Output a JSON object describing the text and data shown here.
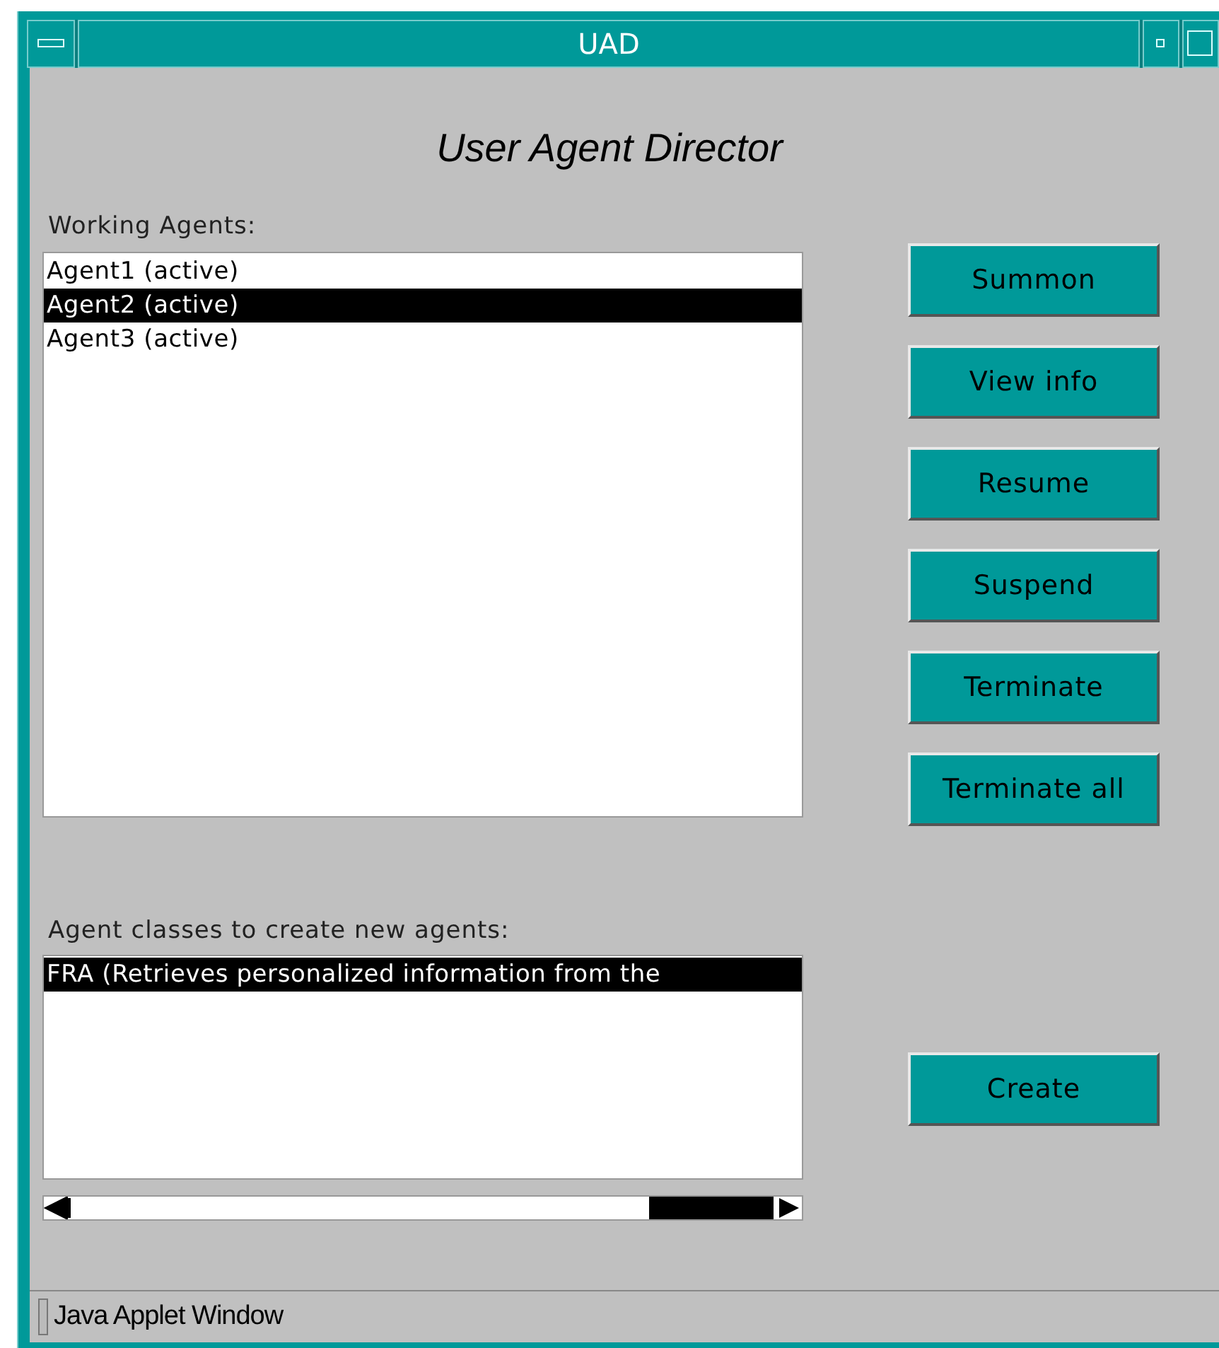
{
  "window": {
    "title": "UAD"
  },
  "heading": "User Agent Director",
  "working_agents": {
    "label": "Working Agents:",
    "items": [
      {
        "text": "Agent1 (active)",
        "selected": false
      },
      {
        "text": "Agent2 (active)",
        "selected": true
      },
      {
        "text": "Agent3 (active)",
        "selected": false
      }
    ]
  },
  "buttons": [
    "Summon",
    "View info",
    "Resume",
    "Suspend",
    "Terminate",
    "Terminate all"
  ],
  "agent_classes": {
    "label": "Agent classes to create new agents:",
    "items": [
      {
        "text": "FRA (Retrieves personalized information from the",
        "selected": true
      }
    ]
  },
  "create_button": "Create",
  "status_bar": "Java Applet Window"
}
